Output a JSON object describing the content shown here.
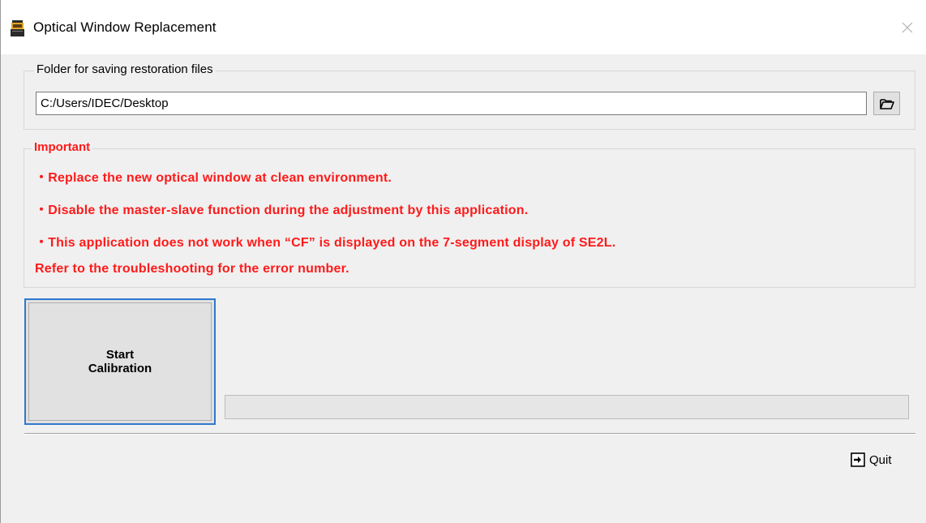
{
  "window": {
    "title": "Optical Window Replacement",
    "icon": "app-icon",
    "close_icon": "close-icon"
  },
  "folder": {
    "group_label": "Folder for saving restoration files",
    "path_value": "C:/Users/IDEC/Desktop",
    "browse_icon": "folder-open-icon"
  },
  "important": {
    "group_label": "Important",
    "notes": [
      "・Replace the new optical window at clean environment.",
      "・Disable the master-slave function during the adjustment by this application.",
      "・This application does not work when “CF” is displayed on the 7-segment display of SE2L.",
      "Refer to the troubleshooting for the error number."
    ],
    "color": "#ff1a1a"
  },
  "actions": {
    "start_line1": "Start",
    "start_line2": "Calibration",
    "progress_fraction": 0,
    "quit_label": "Quit",
    "quit_icon": "exit-icon"
  },
  "colors": {
    "accent_border": "#2f78cc",
    "background": "#f0f0f0"
  }
}
